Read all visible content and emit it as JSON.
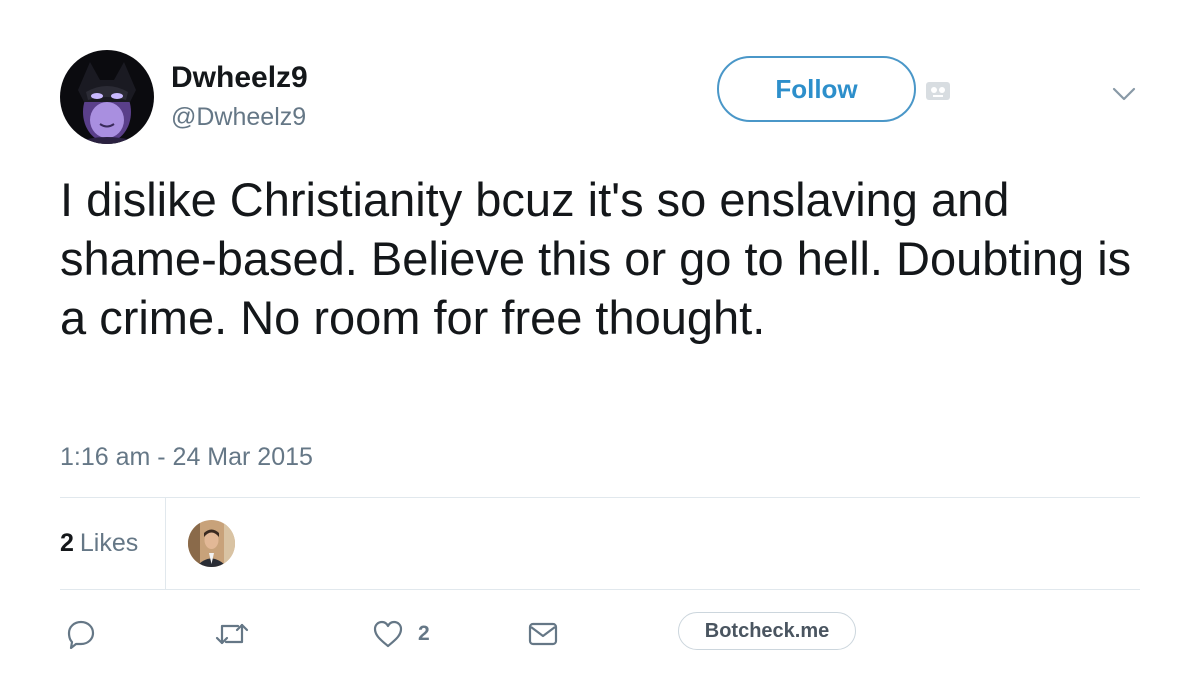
{
  "tweet": {
    "author": {
      "display_name": "Dwheelz9",
      "handle": "@Dwheelz9",
      "avatar_icon": "masked-figure-avatar"
    },
    "follow_label": "Follow",
    "text": "I dislike Christianity bcuz it's so enslaving and shame-based. Believe this or go to hell. Doubting is a crime. No room for free thought.",
    "timestamp": "1:16 am - 24 Mar 2015",
    "stats": {
      "likes_count": "2",
      "likes_label": "Likes"
    },
    "actions": {
      "reply_icon": "reply-icon",
      "retweet_icon": "retweet-icon",
      "like_icon": "heart-icon",
      "like_count": "2",
      "dm_icon": "envelope-icon"
    },
    "botcheck_label": "Botcheck.me"
  },
  "colors": {
    "follow_blue": "#2d8fcb",
    "secondary_text": "#657786",
    "divider": "#e1e8ed"
  }
}
